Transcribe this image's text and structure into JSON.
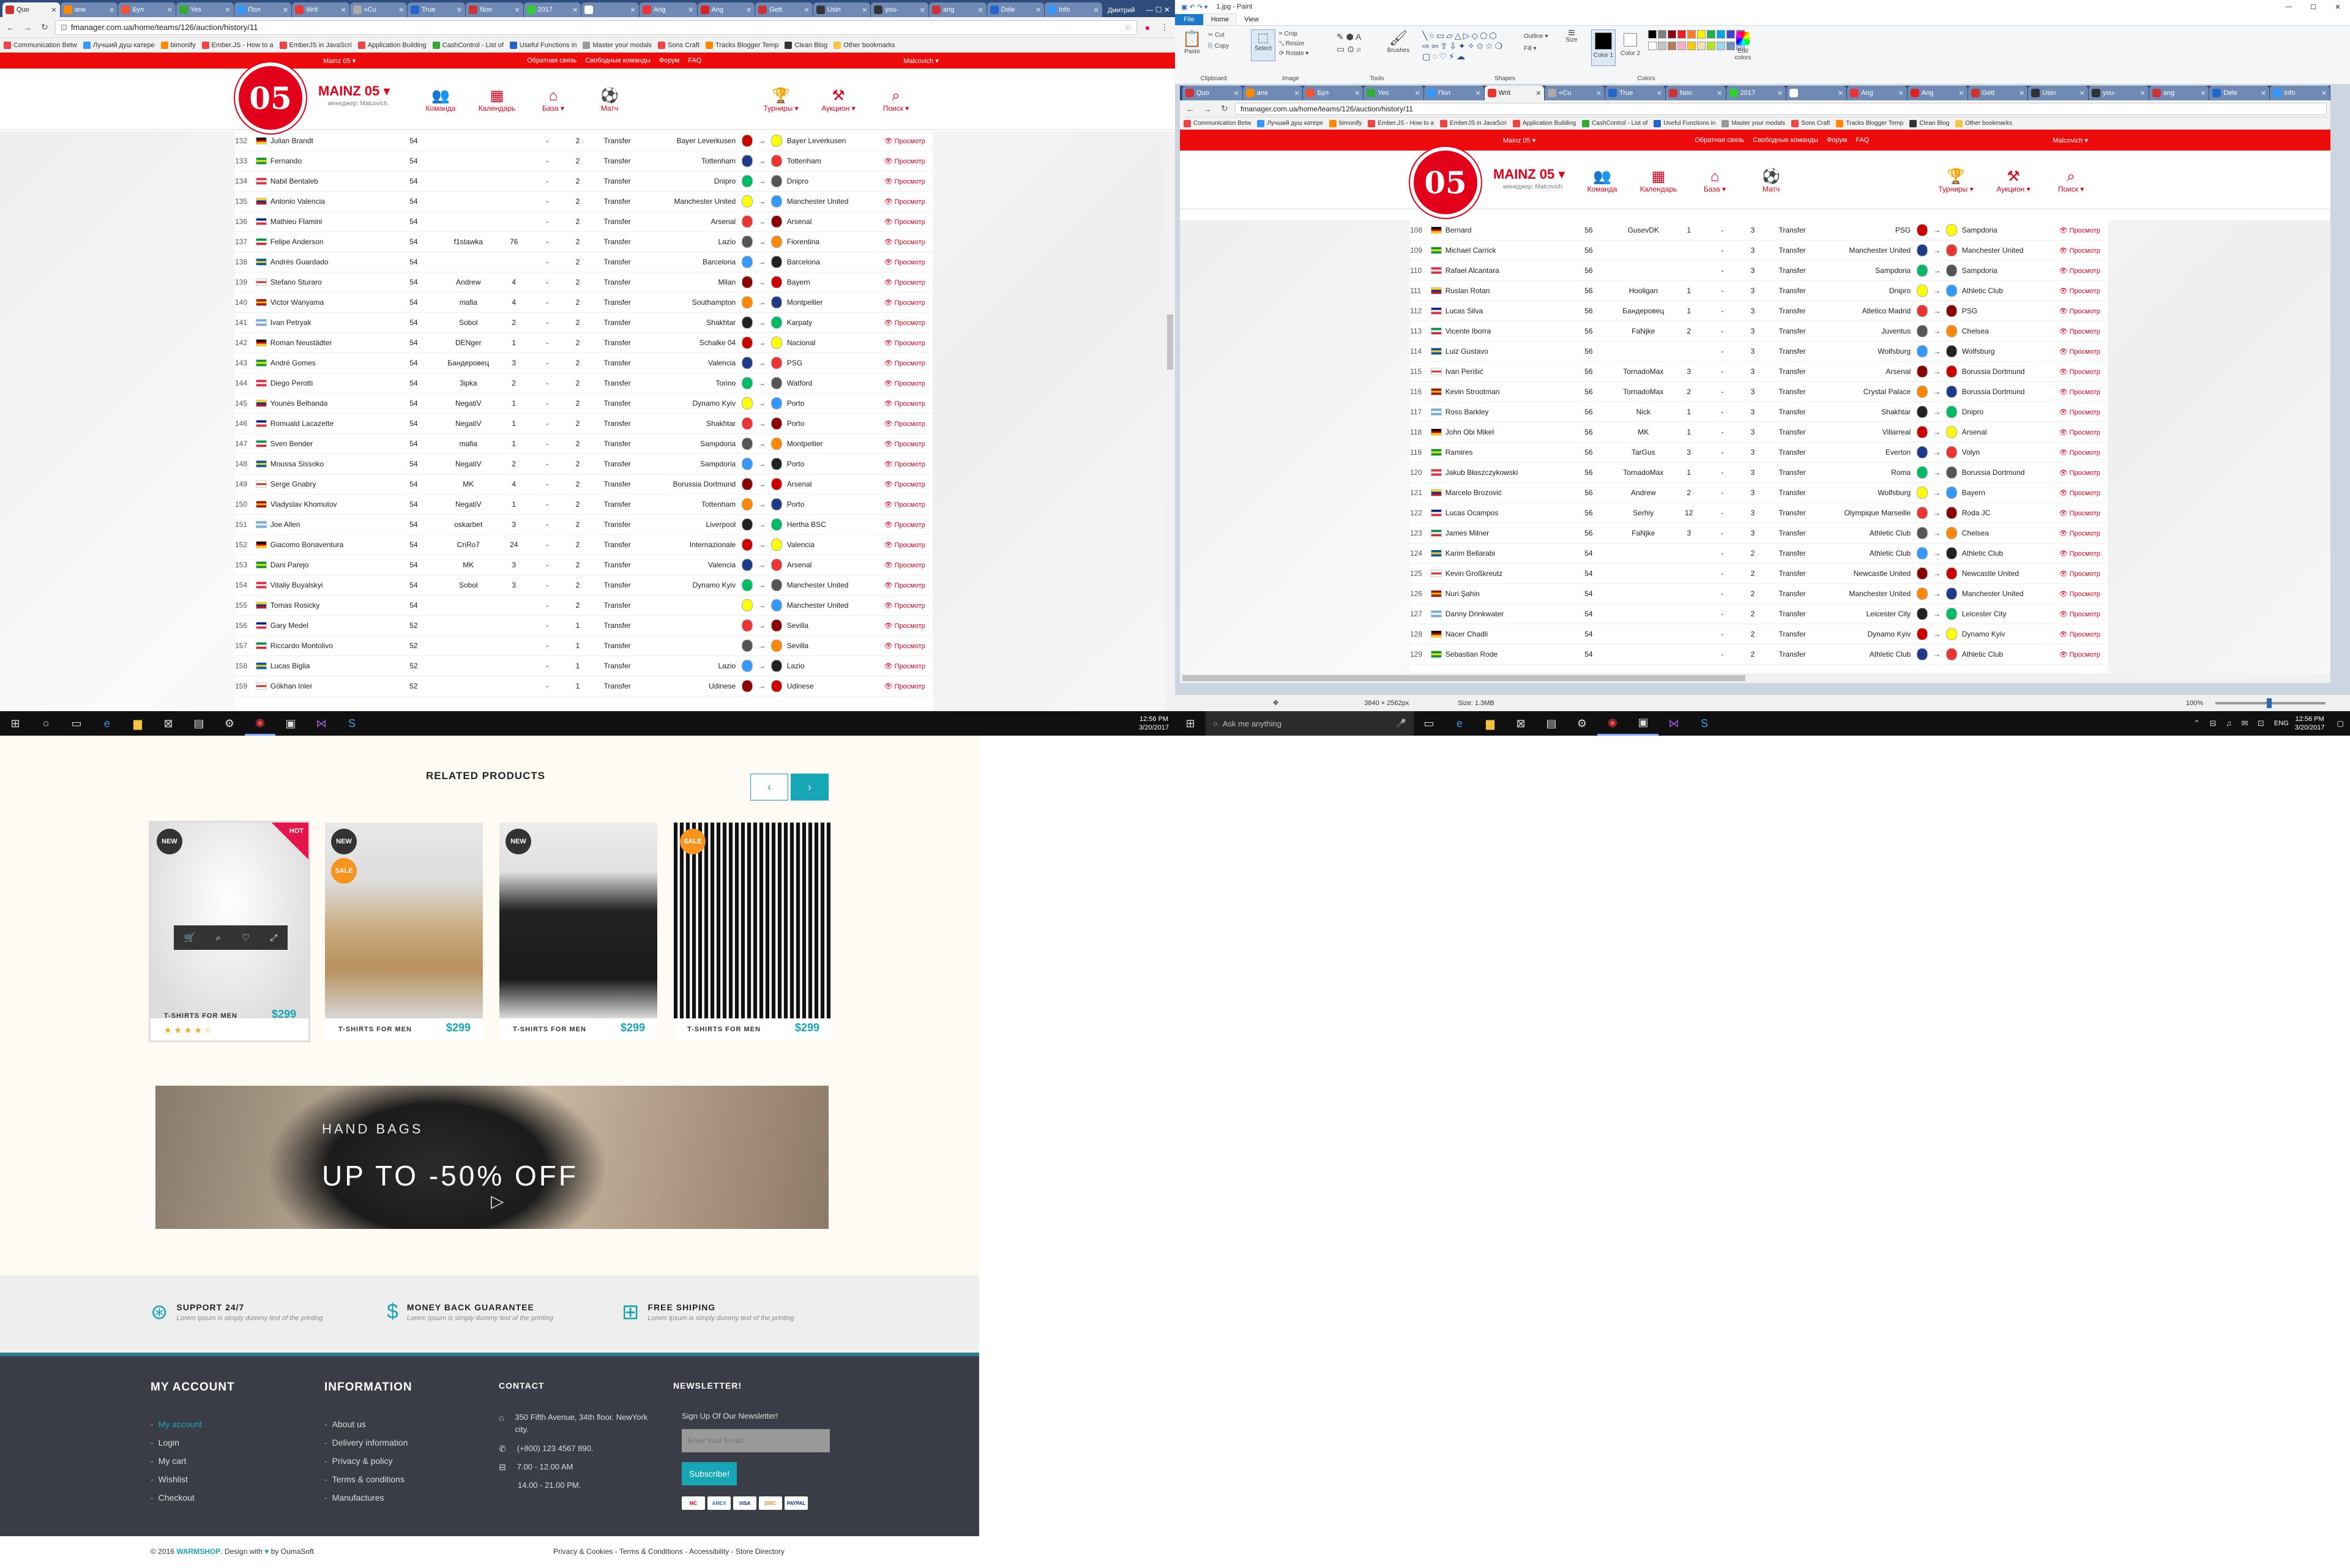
{
  "browser": {
    "tabs": [
      "Quo",
      "ane",
      "Бул",
      "Yes",
      "Пол",
      "Writ",
      "«Cu",
      "True",
      "Noo",
      "2017",
      "",
      "Ang",
      "Ang",
      "Gett",
      "Usin",
      "you-",
      "ang",
      "Dele",
      "Info"
    ],
    "user": "Дмитрий",
    "url": "fmanager.com.ua/home/teams/126/auction/history/11",
    "bookmarks": [
      "Communication Betw",
      "Лучший душ катере",
      "bimonify",
      "Ember.JS - How to a",
      "EmberJS in JavaScri",
      "Application Building",
      "CashControl - List of",
      "Useful Functions in",
      "Master your modals",
      "Sons Craft",
      "Tracks Blogger Temp",
      "Clean Blog",
      "Other bookmarks"
    ]
  },
  "fm": {
    "topbar": {
      "left": "Mainz 05 ▾",
      "feedback": "Обратная связь",
      "free_teams": "Свободные команды",
      "forum": "Форум",
      "faq": "FAQ",
      "user": "Malcovich ▾"
    },
    "logo_mark": "05",
    "club": "MAINZ 05 ▾",
    "manager": "менеджер: Malcovich",
    "nav": [
      {
        "icon": "team-icon",
        "glyph": "👥",
        "label": "Команда"
      },
      {
        "icon": "calendar-icon",
        "glyph": "▦",
        "label": "Календарь"
      },
      {
        "icon": "home-icon",
        "glyph": "⌂",
        "label": "База ▾"
      },
      {
        "icon": "ball-icon",
        "glyph": "⚽",
        "label": "Матч"
      }
    ],
    "nav_right": [
      {
        "icon": "trophy-icon",
        "glyph": "🏆",
        "label": "Турниры ▾"
      },
      {
        "icon": "gavel-icon",
        "glyph": "⚒",
        "label": "Аукцион ▾"
      },
      {
        "icon": "search-icon",
        "glyph": "⌕",
        "label": "Поиск ▾"
      }
    ],
    "view_label": "👁 Просмотр",
    "left_rows": [
      [
        "132",
        "Julian Brandt",
        "54",
        "",
        "",
        "-",
        "2",
        "Transfer",
        "Bayer Leverkusen",
        "Bayer Leverkusen"
      ],
      [
        "133",
        "Fernando",
        "54",
        "",
        "",
        "-",
        "2",
        "Transfer",
        "Tottenham",
        "Tottenham"
      ],
      [
        "134",
        "Nabil Bentaleb",
        "54",
        "",
        "",
        "-",
        "2",
        "Transfer",
        "Dnipro",
        "Dnipro"
      ],
      [
        "135",
        "Antonio Valencia",
        "54",
        "",
        "",
        "-",
        "2",
        "Transfer",
        "Manchester United",
        "Manchester United"
      ],
      [
        "136",
        "Mathieu Flamini",
        "54",
        "",
        "",
        "-",
        "2",
        "Transfer",
        "Arsenal",
        "Arsenal"
      ],
      [
        "137",
        "Felipe Anderson",
        "54",
        "f1stawka",
        "76",
        "-",
        "2",
        "Transfer",
        "Lazio",
        "Fiorentina"
      ],
      [
        "138",
        "Andrés Guardado",
        "54",
        "",
        "",
        "-",
        "2",
        "Transfer",
        "Barcelona",
        "Barcelona"
      ],
      [
        "139",
        "Stefano Sturaro",
        "54",
        "Andrew",
        "4",
        "-",
        "2",
        "Transfer",
        "Milan",
        "Bayern"
      ],
      [
        "140",
        "Victor Wanyama",
        "54",
        "mafia",
        "4",
        "-",
        "2",
        "Transfer",
        "Southampton",
        "Montpellier"
      ],
      [
        "141",
        "Ivan Petryak",
        "54",
        "Sobol",
        "2",
        "-",
        "2",
        "Transfer",
        "Shakhtar",
        "Karpaty"
      ],
      [
        "142",
        "Roman Neustädter",
        "54",
        "DENger",
        "1",
        "-",
        "2",
        "Transfer",
        "Schalke 04",
        "Nacional"
      ],
      [
        "143",
        "André Gomes",
        "54",
        "Бандеровец",
        "3",
        "-",
        "2",
        "Transfer",
        "Valencia",
        "PSG"
      ],
      [
        "144",
        "Diego Perotti",
        "54",
        "3ipka",
        "2",
        "-",
        "2",
        "Transfer",
        "Torino",
        "Watford"
      ],
      [
        "145",
        "Younès Belhanda",
        "54",
        "NegatiV",
        "1",
        "-",
        "2",
        "Transfer",
        "Dynamo Kyiv",
        "Porto"
      ],
      [
        "146",
        "Romuald Lacazette",
        "54",
        "NegatiV",
        "1",
        "-",
        "2",
        "Transfer",
        "Shakhtar",
        "Porto"
      ],
      [
        "147",
        "Sven Bender",
        "54",
        "mafia",
        "1",
        "-",
        "2",
        "Transfer",
        "Sampdoria",
        "Montpellier"
      ],
      [
        "148",
        "Moussa Sissoko",
        "54",
        "NegatiV",
        "2",
        "-",
        "2",
        "Transfer",
        "Sampdoria",
        "Porto"
      ],
      [
        "149",
        "Serge Gnabry",
        "54",
        "MK",
        "4",
        "-",
        "2",
        "Transfer",
        "Borussia Dortmund",
        "Arsenal"
      ],
      [
        "150",
        "Vladyslav Khomutov",
        "54",
        "NegatiV",
        "1",
        "-",
        "2",
        "Transfer",
        "Tottenham",
        "Porto"
      ],
      [
        "151",
        "Joe Allen",
        "54",
        "oskarbet",
        "3",
        "-",
        "2",
        "Transfer",
        "Liverpool",
        "Hertha BSC"
      ],
      [
        "152",
        "Giacomo Bonaventura",
        "54",
        "CriRo7",
        "24",
        "-",
        "2",
        "Transfer",
        "Internazionale",
        "Valencia"
      ],
      [
        "153",
        "Dani Parejo",
        "54",
        "MK",
        "3",
        "-",
        "2",
        "Transfer",
        "Valencia",
        "Arsenal"
      ],
      [
        "154",
        "Vitaliy Buyalskyi",
        "54",
        "Sobol",
        "3",
        "-",
        "2",
        "Transfer",
        "Dynamo Kyiv",
        "Manchester United"
      ],
      [
        "155",
        "Tomas Rosicky",
        "54",
        "",
        "",
        "-",
        "2",
        "Transfer",
        "",
        "Manchester United"
      ],
      [
        "156",
        "Gary Medel",
        "52",
        "",
        "",
        "-",
        "1",
        "Transfer",
        "",
        "Sevilla"
      ],
      [
        "157",
        "Riccardo Montolivo",
        "52",
        "",
        "",
        "-",
        "1",
        "Transfer",
        "",
        "Sevilla"
      ],
      [
        "158",
        "Lucas Biglia",
        "52",
        "",
        "",
        "-",
        "1",
        "Transfer",
        "Lazio",
        "Lazio"
      ],
      [
        "159",
        "Gökhan Inler",
        "52",
        "",
        "",
        "-",
        "1",
        "Transfer",
        "Udinese",
        "Udinese"
      ]
    ],
    "right_rows": [
      [
        "108",
        "Bernard",
        "56",
        "GusevDK",
        "1",
        "-",
        "3",
        "Transfer",
        "PSG",
        "Sampdoria"
      ],
      [
        "109",
        "Michael Carrick",
        "56",
        "",
        "",
        "-",
        "3",
        "Transfer",
        "Manchester United",
        "Manchester United"
      ],
      [
        "110",
        "Rafael Alcantara",
        "56",
        "",
        "",
        "-",
        "3",
        "Transfer",
        "Sampdoria",
        "Sampdoria"
      ],
      [
        "111",
        "Ruslan Rotan",
        "56",
        "Hooligan",
        "1",
        "-",
        "3",
        "Transfer",
        "Dnipro",
        "Athletic Club"
      ],
      [
        "112",
        "Lucas Silva",
        "56",
        "Бандеровец",
        "1",
        "-",
        "3",
        "Transfer",
        "Atletico Madrid",
        "PSG"
      ],
      [
        "113",
        "Vicente Iborra",
        "56",
        "FaNjke",
        "2",
        "-",
        "3",
        "Transfer",
        "Juventus",
        "Chelsea"
      ],
      [
        "114",
        "Luiz Gustavo",
        "56",
        "",
        "",
        "-",
        "3",
        "Transfer",
        "Wolfsburg",
        "Wolfsburg"
      ],
      [
        "115",
        "Ivan Perišić",
        "56",
        "TornadoMax",
        "3",
        "-",
        "3",
        "Transfer",
        "Arsenal",
        "Borussia Dortmund"
      ],
      [
        "116",
        "Kevin Strootman",
        "56",
        "TornadoMax",
        "2",
        "-",
        "3",
        "Transfer",
        "Crystal Palace",
        "Borussia Dortmund"
      ],
      [
        "117",
        "Ross Barkley",
        "56",
        "Nick",
        "1",
        "-",
        "3",
        "Transfer",
        "Shakhtar",
        "Dnipro"
      ],
      [
        "118",
        "John Obi Mikel",
        "56",
        "MK",
        "1",
        "-",
        "3",
        "Transfer",
        "Villarreal",
        "Arsenal"
      ],
      [
        "119",
        "Ramires",
        "56",
        "TarGus",
        "3",
        "-",
        "3",
        "Transfer",
        "Everton",
        "Volyn"
      ],
      [
        "120",
        "Jakub Błaszczykowski",
        "56",
        "TornadoMax",
        "1",
        "-",
        "3",
        "Transfer",
        "Roma",
        "Borussia Dortmund"
      ],
      [
        "121",
        "Marcelo Brozović",
        "56",
        "Andrew",
        "2",
        "-",
        "3",
        "Transfer",
        "Wolfsburg",
        "Bayern"
      ],
      [
        "122",
        "Lucas Ocampos",
        "56",
        "Serhiy",
        "12",
        "-",
        "3",
        "Transfer",
        "Olympique Marseille",
        "Roda JC"
      ],
      [
        "123",
        "James Milner",
        "56",
        "FaNjke",
        "3",
        "-",
        "3",
        "Transfer",
        "Athletic Club",
        "Chelsea"
      ],
      [
        "124",
        "Karim Bellarabi",
        "54",
        "",
        "",
        "-",
        "2",
        "Transfer",
        "Athletic Club",
        "Athletic Club"
      ],
      [
        "125",
        "Kevin Großkreutz",
        "54",
        "",
        "",
        "-",
        "2",
        "Transfer",
        "Newcastle United",
        "Newcastle United"
      ],
      [
        "126",
        "Nuri Şahin",
        "54",
        "",
        "",
        "-",
        "2",
        "Transfer",
        "Manchester United",
        "Manchester United"
      ],
      [
        "127",
        "Danny Drinkwater",
        "54",
        "",
        "",
        "-",
        "2",
        "Transfer",
        "Leicester City",
        "Leicester City"
      ],
      [
        "128",
        "Nacer Chadli",
        "54",
        "",
        "",
        "-",
        "2",
        "Transfer",
        "Dynamo Kyiv",
        "Dynamo Kyiv"
      ],
      [
        "129",
        "Sebastian Rode",
        "54",
        "",
        "",
        "-",
        "2",
        "Transfer",
        "Athletic Club",
        "Athletic Club"
      ]
    ]
  },
  "paint": {
    "title": "1.jpg - Paint",
    "menu": [
      "File",
      "Home",
      "View"
    ],
    "groups": {
      "clipboard": "Clipboard",
      "image": "Image",
      "tools": "Tools",
      "shapes": "Shapes",
      "colors": "Colors"
    },
    "buttons": {
      "paste": "Paste",
      "cut": "Cut",
      "copy": "Copy",
      "select": "Select",
      "crop": "Crop",
      "resize": "Resize",
      "rotate": "Rotate ▾",
      "brushes": "Brushes",
      "outline": "Outline ▾",
      "fill": "Fill ▾",
      "size": "Size",
      "color1": "Color 1",
      "color2": "Color 2",
      "edit_colors": "Edit colors"
    },
    "status": {
      "dims": "3840 × 2562px",
      "size": "Size: 1.3MB",
      "zoom": "100%"
    },
    "palette": [
      "#000000",
      "#7f7f7f",
      "#880015",
      "#ed1c24",
      "#ff7f27",
      "#fff200",
      "#22b14c",
      "#00a2e8",
      "#3f48cc",
      "#a349a4",
      "#ffffff",
      "#c3c3c3",
      "#b97a57",
      "#ffaec9",
      "#ffc90e",
      "#efe4b0",
      "#b5e61d",
      "#99d9ea",
      "#7092be",
      "#c8bfe7"
    ]
  },
  "taskbar": {
    "search_placeholder": "Ask me anything",
    "time": "12:56 PM",
    "date": "3/20/2017",
    "lang": "ENG"
  },
  "shop": {
    "related_title": "RELATED PRODUCTS",
    "products": [
      {
        "badge": "NEW",
        "badge2": "HOT",
        "name": "T-SHIRTS FOR MEN",
        "price": "$299",
        "rating": "★ ★ ★ ★ ☆"
      },
      {
        "badge": "NEW",
        "badge2": "SALE",
        "name": "T-SHIRTS FOR MEN",
        "price": "$299"
      },
      {
        "badge": "NEW",
        "name": "T-SHIRTS FOR MEN",
        "price": "$299"
      },
      {
        "badge": "SALE",
        "name": "T-SHIRTS FOR MEN",
        "price": "$299"
      }
    ],
    "banner": {
      "kicker": "HAND BAGS",
      "headline": "UP TO -50% OFF"
    },
    "features": [
      {
        "icon": "lifebuoy-icon",
        "glyph": "⊛",
        "title": "SUPPORT 24/7",
        "sub": "Lorem Ipsum is simply dummy text of the printing"
      },
      {
        "icon": "money-icon",
        "glyph": "$",
        "title": "MONEY BACK GUARANTEE",
        "sub": "Lorem Ipsum is simply dummy text of the printing"
      },
      {
        "icon": "gift-icon",
        "glyph": "⊞",
        "title": "FREE SHIPING",
        "sub": "Lorem Ipsum is simply dummy text of the printing"
      }
    ],
    "footer": {
      "account": {
        "title": "MY ACCOUNT",
        "links": [
          "My account",
          "Login",
          "My cart",
          "Wishlist",
          "Checkout"
        ]
      },
      "info": {
        "title": "INFORMATION",
        "links": [
          "About us",
          "Delivery information",
          "Privacy & policy",
          "Terms & conditions",
          "Manufactures"
        ]
      },
      "contact": {
        "title": "CONTACT",
        "address": "350 Fifth Avenue, 34th floor. NewYork city.",
        "phone": "(+800) 123 4567 890.",
        "hours1": "7.00 - 12.00 AM",
        "hours2": "14.00 - 21.00 PM."
      },
      "newsletter": {
        "title": "NEWSLETTER!",
        "text": "Sign Up Of Our Newsletter!",
        "placeholder": "Enter Your Email...",
        "button": "Subscribe!",
        "payments": [
          "MC",
          "AMEX",
          "VISA",
          "DISC",
          "PAYPAL"
        ]
      }
    },
    "copyright_pre": "© 2016",
    "brand": "WARMSHOP",
    "design": ". Design with",
    "by": "by OumaSoft",
    "legal": "Privacy & Cookies  -  Terms & Conditions  -  Accessibility  -  Store Directory"
  }
}
